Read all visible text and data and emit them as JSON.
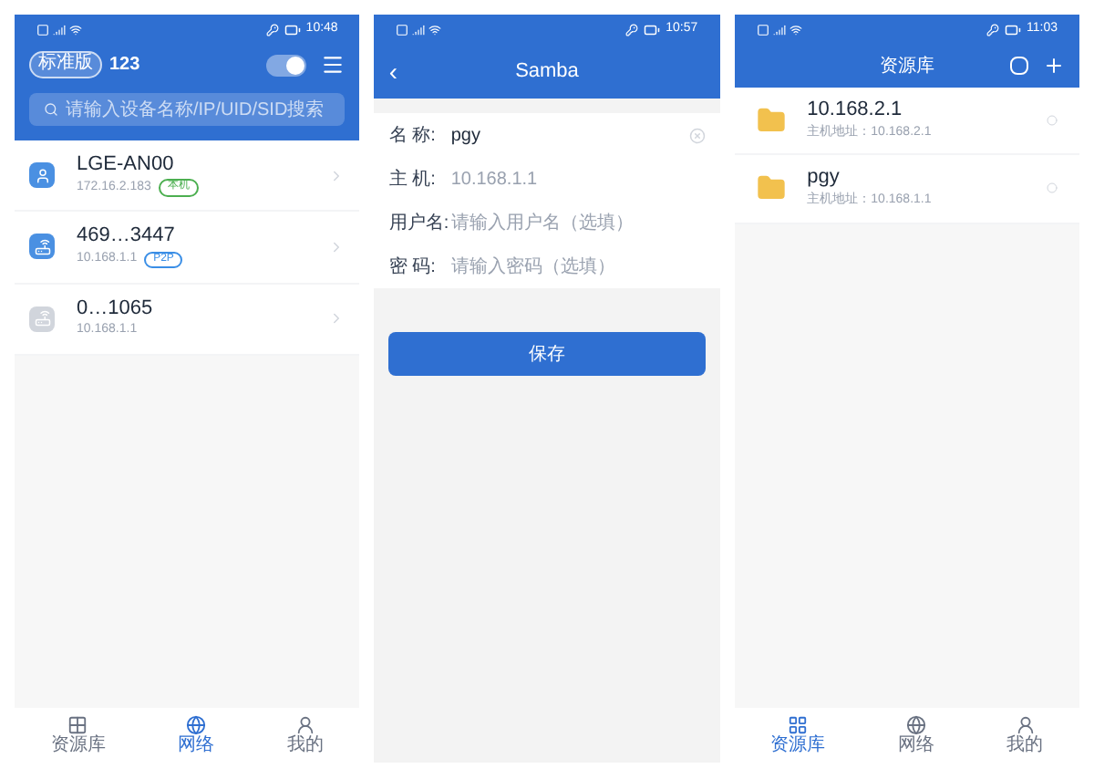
{
  "screens": [
    {
      "kind": "devices",
      "status_time": "10:48",
      "edition": "标准版",
      "account": "123",
      "toggle_on": true,
      "search": {
        "placeholder": "请输入设备名称/IP/UID/SID搜索"
      },
      "devices": [
        {
          "kind": "phone",
          "online": true,
          "name": "LGE-AN00",
          "ip": "172.16.2.183",
          "tag": "本机",
          "color": "#4caf50"
        },
        {
          "kind": "router",
          "online": true,
          "name": "469…3447",
          "ip": "10.168.1.1",
          "tag": "P2P",
          "color": "#3a8ee6"
        },
        {
          "kind": "router",
          "online": false,
          "name": "0…1065",
          "ip": "10.168.1.1"
        }
      ],
      "nav": [
        {
          "label": "资源库",
          "selected": false
        },
        {
          "label": "网络",
          "selected": true
        },
        {
          "label": "我的",
          "selected": false
        }
      ]
    },
    {
      "kind": "form",
      "status_time": "10:57",
      "title": "Samba",
      "back": "‹",
      "fields": [
        {
          "label": "名 称:",
          "value": "pgy",
          "clearable": true
        },
        {
          "label": "主 机:",
          "placeholder": "10.168.1.1"
        },
        {
          "label": "用户名:",
          "placeholder": "请输入用户名（选填）"
        },
        {
          "label": "密 码:",
          "placeholder": "请输入密码（选填）"
        }
      ],
      "save": "保存"
    },
    {
      "kind": "library",
      "status_time": "11:03",
      "title": "资源库",
      "items": [
        {
          "name": "10.168.2.1",
          "address": "主机地址：10.168.2.1"
        },
        {
          "name": "pgy",
          "address": "主机地址：10.168.1.1"
        }
      ],
      "nav": [
        {
          "label": "资源库",
          "selected": true
        },
        {
          "label": "网络",
          "selected": false
        },
        {
          "label": "我的",
          "selected": false
        }
      ]
    }
  ]
}
